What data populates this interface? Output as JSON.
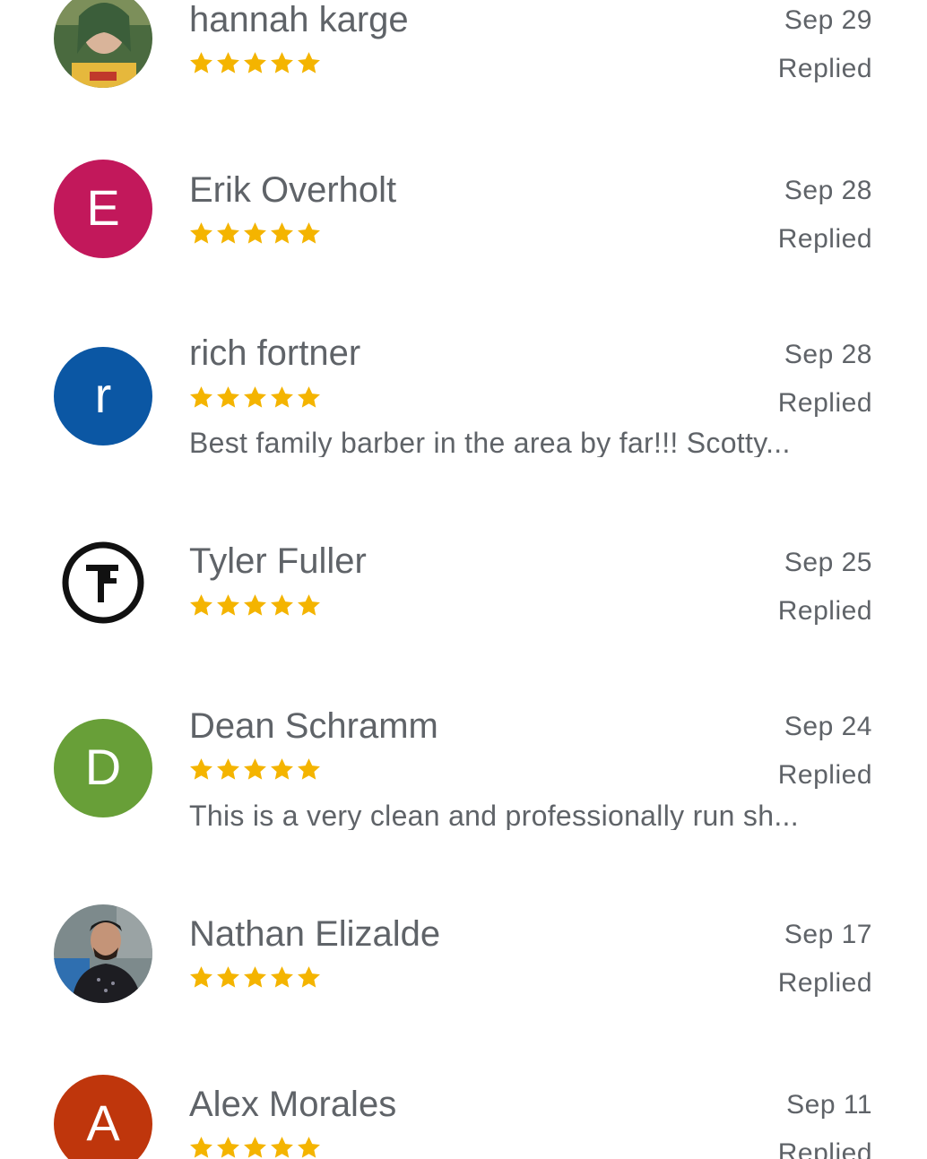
{
  "reviews": [
    {
      "name": "hannah karge",
      "date": "Sep 29",
      "status": "Replied",
      "rating": 5,
      "snippet": "",
      "avatar": {
        "type": "photo",
        "icon": "user-photo",
        "colors": [
          "#3d5a3a",
          "#e0b94a",
          "#7a8f4e"
        ]
      }
    },
    {
      "name": "Erik Overholt",
      "date": "Sep 28",
      "status": "Replied",
      "rating": 5,
      "snippet": "",
      "avatar": {
        "type": "letter",
        "letter": "E",
        "color": "#c2185b"
      }
    },
    {
      "name": "rich fortner",
      "date": "Sep 28",
      "status": "Replied",
      "rating": 5,
      "snippet": "Best family barber in the area by far!!! Scotty...",
      "avatar": {
        "type": "letter",
        "letter": "r",
        "color": "#0b57a4"
      }
    },
    {
      "name": "Tyler Fuller",
      "date": "Sep 25",
      "status": "Replied",
      "rating": 5,
      "snippet": "",
      "avatar": {
        "type": "logo",
        "icon": "tf-monogram-logo",
        "color": "#111111"
      }
    },
    {
      "name": "Dean Schramm",
      "date": "Sep 24",
      "status": "Replied",
      "rating": 5,
      "snippet": "This is a very clean and professionally run sh...",
      "avatar": {
        "type": "letter",
        "letter": "D",
        "color": "#689f38"
      }
    },
    {
      "name": "Nathan Elizalde",
      "date": "Sep 17",
      "status": "Replied",
      "rating": 5,
      "snippet": "",
      "avatar": {
        "type": "photo",
        "icon": "user-photo",
        "colors": [
          "#6b7b7e",
          "#1e1e22",
          "#c89a7a"
        ]
      }
    },
    {
      "name": "Alex Morales",
      "date": "Sep 11",
      "status": "Replied",
      "rating": 5,
      "snippet": "",
      "avatar": {
        "type": "letter",
        "letter": "A",
        "color": "#bf360c"
      }
    }
  ],
  "theme": {
    "star_color": "#f4b400",
    "text_color": "#5f6368"
  }
}
